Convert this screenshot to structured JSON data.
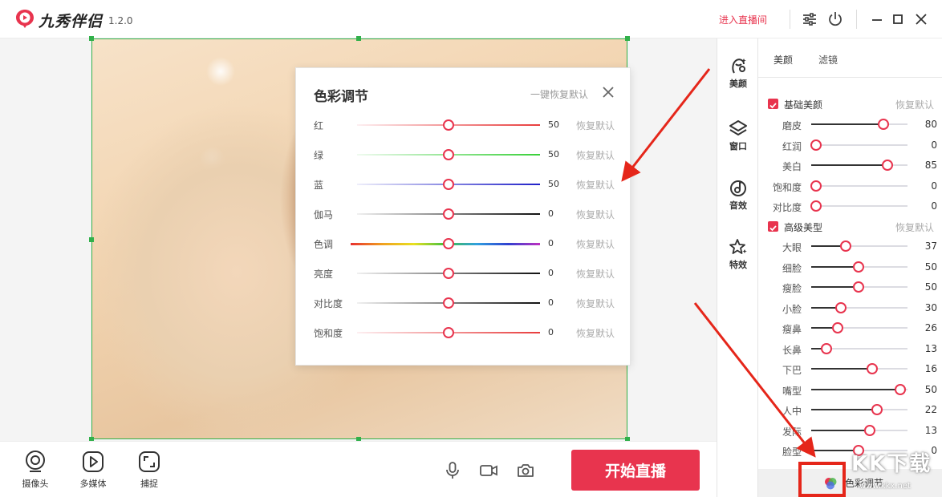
{
  "app": {
    "name": "九秀伴侣",
    "version": "1.2.0",
    "brand_color": "#e8344e"
  },
  "topbar": {
    "enter_live": "进入直播间",
    "icons": [
      "settings-sliders-icon",
      "power-icon",
      "minimize-icon",
      "maximize-icon",
      "close-icon"
    ]
  },
  "bottombar": {
    "tools": [
      {
        "label": "摄像头",
        "icon": "webcam-icon"
      },
      {
        "label": "多媒体",
        "icon": "play-icon"
      },
      {
        "label": "捕捉",
        "icon": "capture-icon"
      }
    ],
    "media_icons": [
      "microphone-icon",
      "video-camera-icon",
      "camera-icon"
    ],
    "start_live": "开始直播"
  },
  "color_dialog": {
    "title": "色彩调节",
    "reset_all": "一键恢复默认",
    "rows": [
      {
        "label": "红",
        "value": "50",
        "reset": "恢复默认",
        "level": 0.5,
        "track": "red"
      },
      {
        "label": "绿",
        "value": "50",
        "reset": "恢复默认",
        "level": 0.5,
        "track": "green"
      },
      {
        "label": "蓝",
        "value": "50",
        "reset": "恢复默认",
        "level": 0.5,
        "track": "blue"
      },
      {
        "label": "伽马",
        "value": "0",
        "reset": "恢复默认",
        "level": 0.5,
        "track": "gray"
      },
      {
        "label": "色调",
        "value": "0",
        "reset": "恢复默认",
        "level": 0.5,
        "track": "rainbow"
      },
      {
        "label": "亮度",
        "value": "0",
        "reset": "恢复默认",
        "level": 0.5,
        "track": "gray"
      },
      {
        "label": "对比度",
        "value": "0",
        "reset": "恢复默认",
        "level": 0.5,
        "track": "gray"
      },
      {
        "label": "饱和度",
        "value": "0",
        "reset": "恢复默认",
        "level": 0.5,
        "track": "red"
      }
    ]
  },
  "right_icons": [
    {
      "label": "美颜",
      "icon": "beauty-icon"
    },
    {
      "label": "窗口",
      "icon": "layers-icon"
    },
    {
      "label": "音效",
      "icon": "music-note-icon"
    },
    {
      "label": "特效",
      "icon": "sparkle-star-icon"
    }
  ],
  "right_panel": {
    "tabs": [
      "美颜",
      "滤镜"
    ],
    "basic": {
      "title": "基础美颜",
      "reset": "恢复默认",
      "items": [
        {
          "label": "磨皮",
          "value": "80",
          "level": 0.76
        },
        {
          "label": "红润",
          "value": "0",
          "level": 0.06
        },
        {
          "label": "美白",
          "value": "85",
          "level": 0.8
        },
        {
          "label": "饱和度",
          "value": "0",
          "level": 0.06
        },
        {
          "label": "对比度",
          "value": "0",
          "level": 0.06
        }
      ]
    },
    "advanced": {
      "title": "高级美型",
      "reset": "恢复默认",
      "items": [
        {
          "label": "大眼",
          "value": "37",
          "level": 0.37
        },
        {
          "label": "细脸",
          "value": "50",
          "level": 0.5
        },
        {
          "label": "瘦脸",
          "value": "50",
          "level": 0.5
        },
        {
          "label": "小脸",
          "value": "30",
          "level": 0.32
        },
        {
          "label": "瘦鼻",
          "value": "26",
          "level": 0.28
        },
        {
          "label": "长鼻",
          "value": "13",
          "level": 0.17
        },
        {
          "label": "下巴",
          "value": "16",
          "level": 0.64
        },
        {
          "label": "嘴型",
          "value": "50",
          "level": 0.93
        },
        {
          "label": "人中",
          "value": "22",
          "level": 0.69
        },
        {
          "label": "发际",
          "value": "13",
          "level": 0.62
        },
        {
          "label": "脸型",
          "value": "0",
          "level": 0.5
        }
      ]
    },
    "color_button": "色彩调节"
  },
  "watermark": {
    "logo": "KK下载",
    "url": "www.kkx.net"
  }
}
